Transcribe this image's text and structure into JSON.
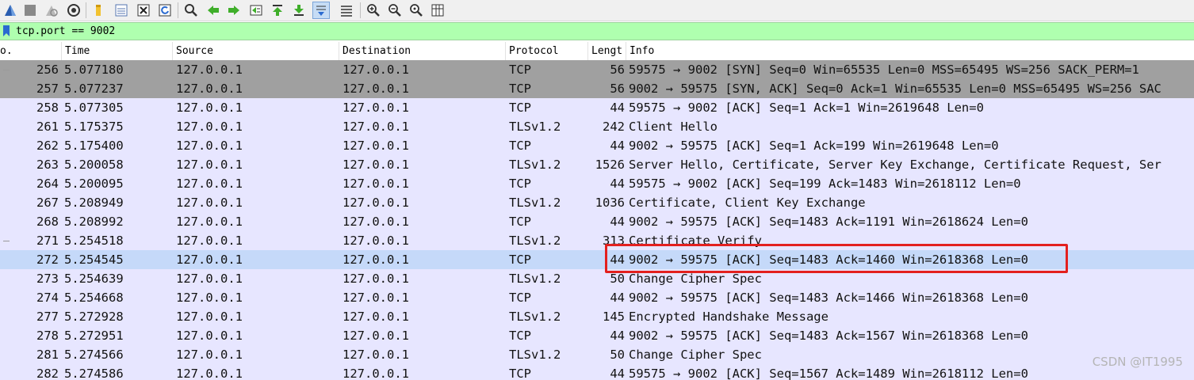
{
  "toolbar": {
    "buttons": [
      {
        "name": "start-capture-icon"
      },
      {
        "name": "stop-capture-icon"
      },
      {
        "name": "restart-capture-icon"
      },
      {
        "name": "capture-options-icon"
      },
      {
        "name": "open-file-icon"
      },
      {
        "name": "save-file-icon"
      },
      {
        "name": "close-file-icon"
      },
      {
        "name": "reload-file-icon"
      },
      {
        "name": "find-packet-icon"
      },
      {
        "name": "go-back-icon"
      },
      {
        "name": "go-forward-icon"
      },
      {
        "name": "go-to-packet-icon"
      },
      {
        "name": "go-first-packet-icon"
      },
      {
        "name": "go-last-packet-icon"
      },
      {
        "name": "autoscroll-icon"
      },
      {
        "name": "colorize-icon"
      },
      {
        "name": "zoom-in-icon"
      },
      {
        "name": "zoom-out-icon"
      },
      {
        "name": "zoom-normal-icon"
      },
      {
        "name": "resize-columns-icon"
      }
    ]
  },
  "filter": {
    "value": "tcp.port == 9002"
  },
  "columns": [
    "o.",
    "Time",
    "Source",
    "Destination",
    "Protocol",
    "Lengt",
    "Info"
  ],
  "packets": [
    {
      "no": "256",
      "time": "5.077180",
      "source": "127.0.0.1",
      "destination": "127.0.0.1",
      "protocol": "TCP",
      "length": "56",
      "info": "59575 → 9002 [SYN] Seq=0 Win=65535 Len=0 MSS=65495 WS=256 SACK_PERM=1"
    },
    {
      "no": "257",
      "time": "5.077237",
      "source": "127.0.0.1",
      "destination": "127.0.0.1",
      "protocol": "TCP",
      "length": "56",
      "info": "9002 → 59575 [SYN, ACK] Seq=0 Ack=1 Win=65535 Len=0 MSS=65495 WS=256 SAC"
    },
    {
      "no": "258",
      "time": "5.077305",
      "source": "127.0.0.1",
      "destination": "127.0.0.1",
      "protocol": "TCP",
      "length": "44",
      "info": "59575 → 9002 [ACK] Seq=1 Ack=1 Win=2619648 Len=0"
    },
    {
      "no": "261",
      "time": "5.175375",
      "source": "127.0.0.1",
      "destination": "127.0.0.1",
      "protocol": "TLSv1.2",
      "length": "242",
      "info": "Client Hello"
    },
    {
      "no": "262",
      "time": "5.175400",
      "source": "127.0.0.1",
      "destination": "127.0.0.1",
      "protocol": "TCP",
      "length": "44",
      "info": "9002 → 59575 [ACK] Seq=1 Ack=199 Win=2619648 Len=0"
    },
    {
      "no": "263",
      "time": "5.200058",
      "source": "127.0.0.1",
      "destination": "127.0.0.1",
      "protocol": "TLSv1.2",
      "length": "1526",
      "info": "Server Hello, Certificate, Server Key Exchange, Certificate Request, Ser"
    },
    {
      "no": "264",
      "time": "5.200095",
      "source": "127.0.0.1",
      "destination": "127.0.0.1",
      "protocol": "TCP",
      "length": "44",
      "info": "59575 → 9002 [ACK] Seq=199 Ack=1483 Win=2618112 Len=0"
    },
    {
      "no": "267",
      "time": "5.208949",
      "source": "127.0.0.1",
      "destination": "127.0.0.1",
      "protocol": "TLSv1.2",
      "length": "1036",
      "info": "Certificate, Client Key Exchange"
    },
    {
      "no": "268",
      "time": "5.208992",
      "source": "127.0.0.1",
      "destination": "127.0.0.1",
      "protocol": "TCP",
      "length": "44",
      "info": "9002 → 59575 [ACK] Seq=1483 Ack=1191 Win=2618624 Len=0"
    },
    {
      "no": "271",
      "time": "5.254518",
      "source": "127.0.0.1",
      "destination": "127.0.0.1",
      "protocol": "TLSv1.2",
      "length": "313",
      "info": "Certificate Verify"
    },
    {
      "no": "272",
      "time": "5.254545",
      "source": "127.0.0.1",
      "destination": "127.0.0.1",
      "protocol": "TCP",
      "length": "44",
      "info": "9002 → 59575 [ACK] Seq=1483 Ack=1460 Win=2618368 Len=0"
    },
    {
      "no": "273",
      "time": "5.254639",
      "source": "127.0.0.1",
      "destination": "127.0.0.1",
      "protocol": "TLSv1.2",
      "length": "50",
      "info": "Change Cipher Spec"
    },
    {
      "no": "274",
      "time": "5.254668",
      "source": "127.0.0.1",
      "destination": "127.0.0.1",
      "protocol": "TCP",
      "length": "44",
      "info": "9002 → 59575 [ACK] Seq=1483 Ack=1466 Win=2618368 Len=0"
    },
    {
      "no": "277",
      "time": "5.272928",
      "source": "127.0.0.1",
      "destination": "127.0.0.1",
      "protocol": "TLSv1.2",
      "length": "145",
      "info": "Encrypted Handshake Message"
    },
    {
      "no": "278",
      "time": "5.272951",
      "source": "127.0.0.1",
      "destination": "127.0.0.1",
      "protocol": "TCP",
      "length": "44",
      "info": "9002 → 59575 [ACK] Seq=1483 Ack=1567 Win=2618368 Len=0"
    },
    {
      "no": "281",
      "time": "5.274566",
      "source": "127.0.0.1",
      "destination": "127.0.0.1",
      "protocol": "TLSv1.2",
      "length": "50",
      "info": "Change Cipher Spec"
    },
    {
      "no": "282",
      "time": "5.274586",
      "source": "127.0.0.1",
      "destination": "127.0.0.1",
      "protocol": "TCP",
      "length": "44",
      "info": "59575 → 9002 [ACK] Seq=1567 Ack=1489 Win=2618112 Len=0"
    }
  ],
  "row_colors": {
    "syn": "#a0a0a0",
    "tcp": "#e7e6ff",
    "selected": "#c5d9f9"
  },
  "selected_packet": "272",
  "watermark": "CSDN @IT1995"
}
